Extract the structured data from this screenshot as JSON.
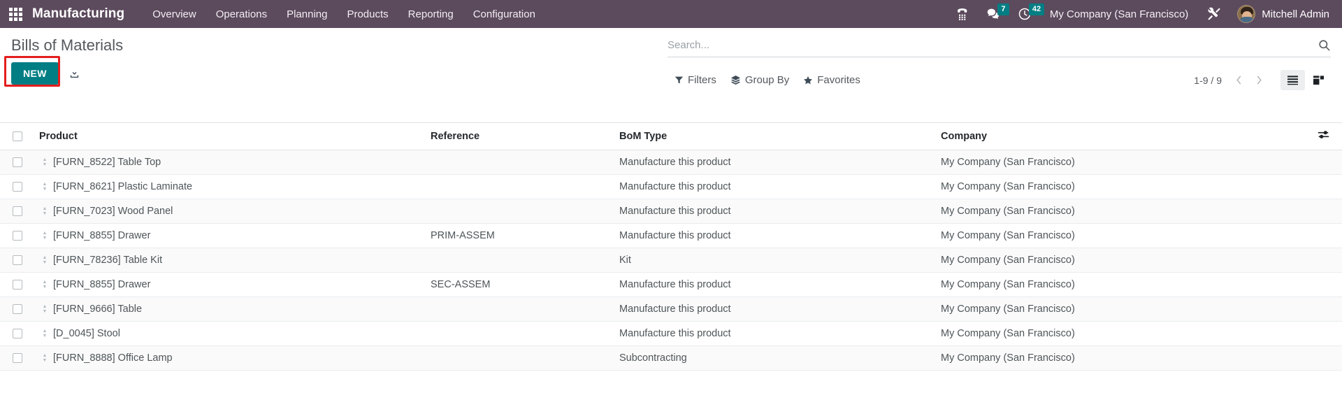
{
  "navbar": {
    "apps_icon": "apps-grid-icon",
    "brand": "Manufacturing",
    "menu": [
      {
        "label": "Overview"
      },
      {
        "label": "Operations"
      },
      {
        "label": "Planning"
      },
      {
        "label": "Products"
      },
      {
        "label": "Reporting"
      },
      {
        "label": "Configuration"
      }
    ],
    "systray": {
      "dialpad_icon": "dialpad-icon",
      "messages_icon": "chat-bubble-icon",
      "messages_count": "7",
      "activities_icon": "clock-icon",
      "activities_count": "42",
      "company": "My Company (San Francisco)",
      "tools_icon": "wrench-screwdriver-icon",
      "user": "Mitchell Admin",
      "avatar": "user-avatar"
    },
    "colors": {
      "bar_bg": "#5C4A5D",
      "badge_bg": "#017E84"
    }
  },
  "control_panel": {
    "title": "Bills of Materials",
    "new_label": "NEW",
    "import_icon": "import-download-icon",
    "highlight_color": "#e41e1e",
    "new_button_color": "#017E84",
    "search": {
      "placeholder": "Search...",
      "value": "",
      "search_icon": "magnifier-icon"
    },
    "dropdowns": [
      {
        "label": "Filters",
        "icon": "filter-funnel-icon"
      },
      {
        "label": "Group By",
        "icon": "layers-icon"
      },
      {
        "label": "Favorites",
        "icon": "star-icon"
      }
    ],
    "pager": {
      "value": "1-9 / 9",
      "prev_icon": "chevron-left-icon",
      "next_icon": "chevron-right-icon"
    },
    "views": [
      {
        "name": "list",
        "icon": "list-view-icon",
        "active": true
      },
      {
        "name": "kanban",
        "icon": "kanban-view-icon",
        "active": false
      }
    ]
  },
  "list": {
    "columns": [
      {
        "key": "product",
        "label": "Product"
      },
      {
        "key": "reference",
        "label": "Reference"
      },
      {
        "key": "bom_type",
        "label": "BoM Type"
      },
      {
        "key": "company",
        "label": "Company"
      }
    ],
    "optional_columns_icon": "sliders-toggle-icon",
    "select_all_checkbox": "select-all",
    "rows": [
      {
        "product": "[FURN_8522] Table Top",
        "reference": "",
        "bom_type": "Manufacture this product",
        "company": "My Company (San Francisco)"
      },
      {
        "product": "[FURN_8621] Plastic Laminate",
        "reference": "",
        "bom_type": "Manufacture this product",
        "company": "My Company (San Francisco)"
      },
      {
        "product": "[FURN_7023] Wood Panel",
        "reference": "",
        "bom_type": "Manufacture this product",
        "company": "My Company (San Francisco)"
      },
      {
        "product": "[FURN_8855] Drawer",
        "reference": "PRIM-ASSEM",
        "bom_type": "Manufacture this product",
        "company": "My Company (San Francisco)"
      },
      {
        "product": "[FURN_78236] Table Kit",
        "reference": "",
        "bom_type": "Kit",
        "company": "My Company (San Francisco)"
      },
      {
        "product": "[FURN_8855] Drawer",
        "reference": "SEC-ASSEM",
        "bom_type": "Manufacture this product",
        "company": "My Company (San Francisco)"
      },
      {
        "product": "[FURN_9666] Table",
        "reference": "",
        "bom_type": "Manufacture this product",
        "company": "My Company (San Francisco)"
      },
      {
        "product": "[D_0045] Stool",
        "reference": "",
        "bom_type": "Manufacture this product",
        "company": "My Company (San Francisco)"
      },
      {
        "product": "[FURN_8888] Office Lamp",
        "reference": "",
        "bom_type": "Subcontracting",
        "company": "My Company (San Francisco)"
      }
    ]
  }
}
